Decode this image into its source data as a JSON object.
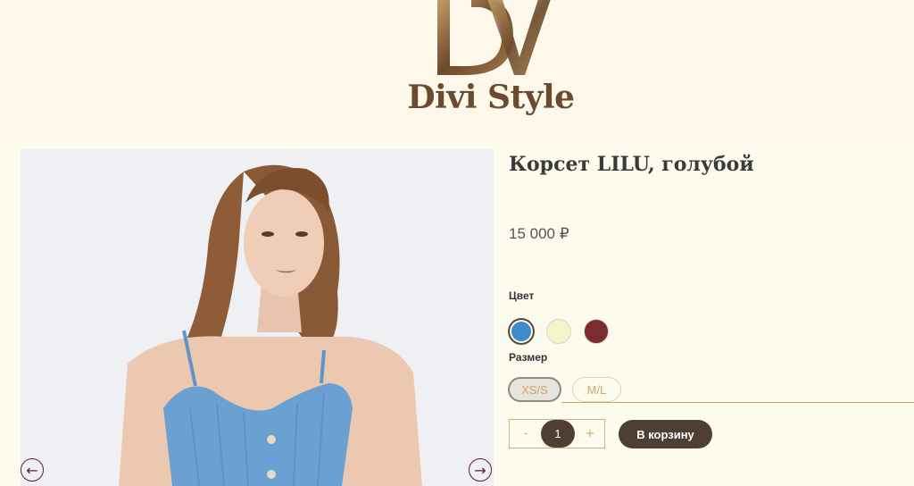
{
  "header": {
    "logo_monogram": "DV",
    "logo_brand": "Divi Style"
  },
  "product": {
    "title": "Корсет LILU, голубой",
    "price": "15 000 ₽",
    "image_prev_icon": "arrow-left-icon",
    "image_next_icon": "arrow-right-icon"
  },
  "options": {
    "color_label": "Цвет",
    "colors": [
      "#3d8bc9",
      "#f3f5c8",
      "#7b2c30"
    ],
    "selected_color": "#3d8bc9",
    "size_label": "Размер",
    "sizes": [
      "XS/S",
      "M/L"
    ],
    "selected_size": "XS/S"
  },
  "cart": {
    "minus": "-",
    "quantity": "1",
    "plus": "+",
    "add_label": "В корзину"
  },
  "colors": {
    "background": "#fdfaee",
    "accent": "#4e3f35",
    "gold": "#d0a46d",
    "arrow": "#5a2131"
  }
}
